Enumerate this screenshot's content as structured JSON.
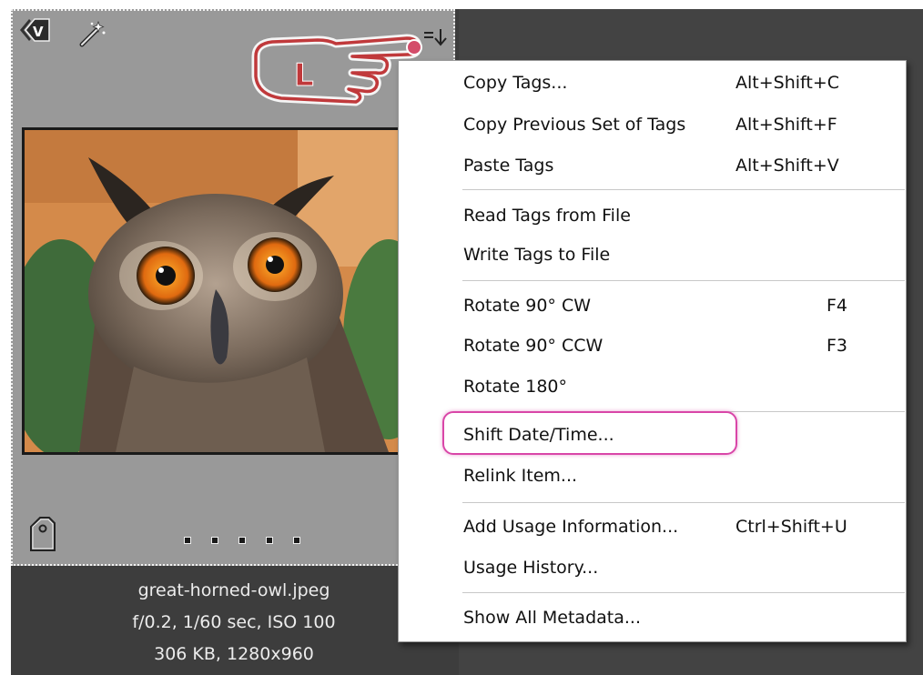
{
  "thumbnail": {
    "badge_letter": "V",
    "annotation_letter": "L",
    "dots_count_label": "5",
    "icons": [
      "version-set-icon",
      "magic-wand-icon",
      "menu-dropdown-icon",
      "tag-icon"
    ]
  },
  "caption": {
    "filename": "great-horned-owl.jpeg",
    "exposure": "f/0.2, 1/60 sec, ISO 100",
    "size": "306 KB, 1280x960"
  },
  "context_menu": {
    "items": [
      {
        "label": "Copy Tags...",
        "shortcut": "Alt+Shift+C"
      },
      {
        "label": "Copy Previous Set of Tags",
        "shortcut": "Alt+Shift+F"
      },
      {
        "label": "Paste Tags",
        "shortcut": "Alt+Shift+V"
      },
      {
        "label": "Read Tags from File",
        "shortcut": ""
      },
      {
        "label": "Write Tags to File",
        "shortcut": ""
      },
      {
        "label": "Rotate 90° CW",
        "shortcut": "F4"
      },
      {
        "label": "Rotate 90° CCW",
        "shortcut": "F3"
      },
      {
        "label": "Rotate 180°",
        "shortcut": ""
      },
      {
        "label": "Shift Date/Time...",
        "shortcut": ""
      },
      {
        "label": "Relink Item...",
        "shortcut": ""
      },
      {
        "label": "Add Usage Information...",
        "shortcut": "Ctrl+Shift+U"
      },
      {
        "label": "Usage History...",
        "shortcut": ""
      },
      {
        "label": "Show All Metadata...",
        "shortcut": ""
      }
    ]
  },
  "colors": {
    "highlight": "#d946a8",
    "annotation": "#c0393b",
    "card_bg": "#999999",
    "dark_bg": "#3d3d3d"
  }
}
